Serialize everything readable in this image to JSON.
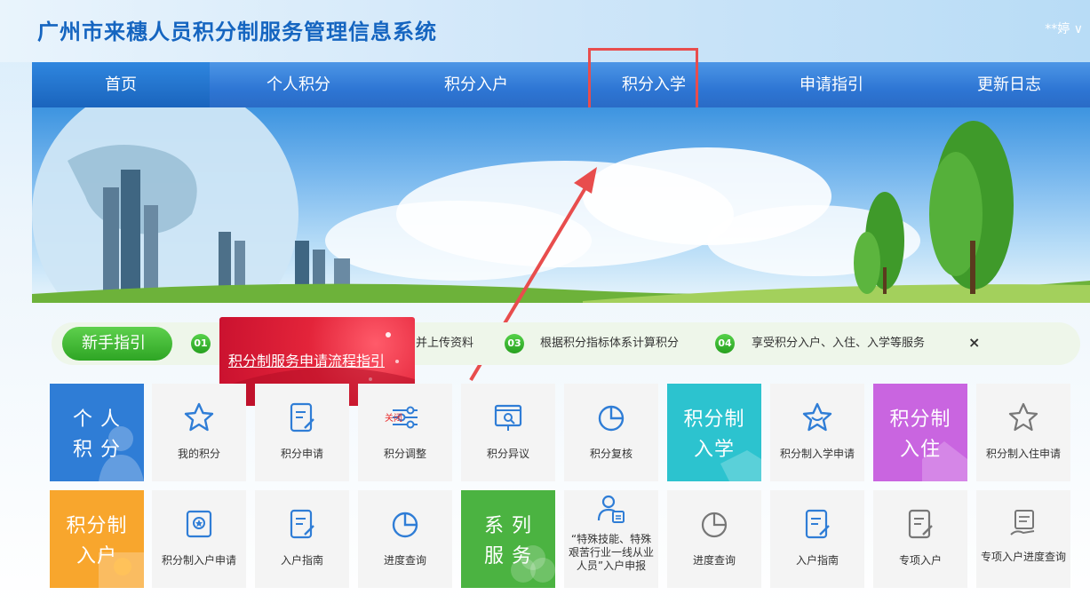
{
  "header": {
    "title": "广州市来穗人员积分制服务管理信息系统",
    "user": "**婷 ∨"
  },
  "nav": {
    "items": [
      "首页",
      "个人积分",
      "积分入户",
      "积分入学",
      "申请指引",
      "更新日志"
    ]
  },
  "guide": {
    "label": "新手指引",
    "steps": [
      {
        "num": "01",
        "text": "并上传资料"
      },
      {
        "num": "03",
        "text": "根据积分指标体系计算积分"
      },
      {
        "num": "04",
        "text": "享受积分入户、入住、入学等服务"
      }
    ],
    "close": "×"
  },
  "popup": {
    "link": "积分制服务申请流程指引"
  },
  "categories": {
    "personal": {
      "line1": "个 人",
      "line2": "积 分",
      "color": "#2f7dd6"
    },
    "school": {
      "line1": "积分制",
      "line2": "入学",
      "color": "#2cc3cf"
    },
    "housing": {
      "line1": "积分制",
      "line2": "入住",
      "color": "#c965e0"
    },
    "hukou": {
      "line1": "积分制",
      "line2": "入户",
      "color": "#f8a62d"
    },
    "series": {
      "line1": "系 列",
      "line2": "服 务",
      "color": "#4bb341"
    }
  },
  "tiles": {
    "my_points": "我的积分",
    "apply_points": "积分申请",
    "adjust_points": "积分调整",
    "dispute_points": "积分异议",
    "review_points": "积分复核",
    "school_apply": "积分制入学申请",
    "housing_apply": "积分制入住申请",
    "hukou_apply": "积分制入户申请",
    "hukou_guide": "入户指南",
    "progress_query": "进度查询",
    "special_talent": "“特殊技能、特殊艰苦行业一线从业人员”入户申报",
    "progress_query_2": "进度查询",
    "hukou_guide_2": "入户指南",
    "special_hukou": "专项入户",
    "special_hukou_progress": "专项入户进度查询",
    "close_badge": "关闭"
  },
  "colors": {
    "accent": "#1565c0",
    "nav": "#2e76d4",
    "guide_green": "#2ea524",
    "popup_red": "#c8102e",
    "annotation": "#e84d4d"
  }
}
